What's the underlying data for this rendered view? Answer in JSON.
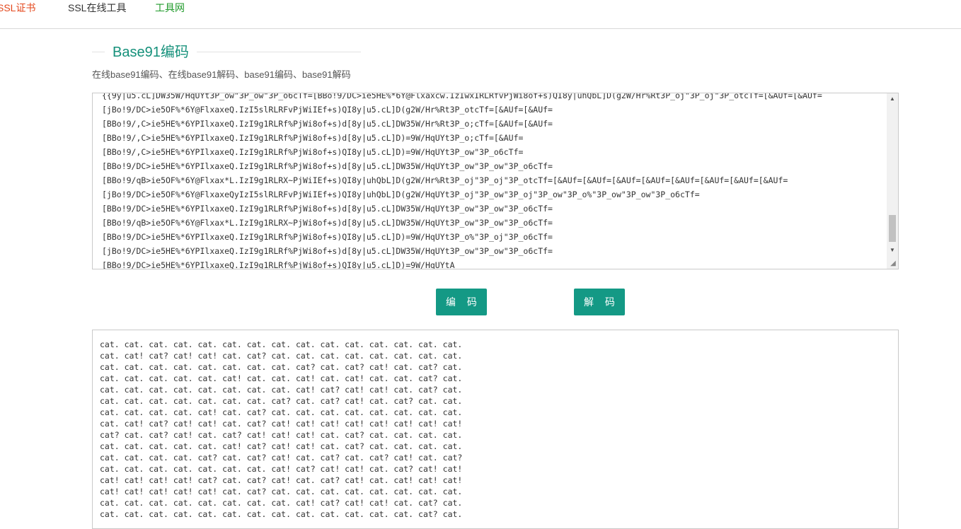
{
  "nav": {
    "ssl_cert": "SSL证书",
    "ssl_tools": "SSL在线工具",
    "tools_net": "工具网"
  },
  "page": {
    "title": "Base91编码",
    "subtitle": "在线base91编码、在线base91解码、base91编码、base91解码"
  },
  "input": {
    "text": "{{9y|u5.cL]DW35W/HqUYt3P_ow\"3P_ow\"3P_o6cTf=[BBo!9/DC>ie5HE%*6Y@Flxaxcw.IzIwxIRLRfvPjWi8of+s)QI8y|uhQbL]D(g2W/Hr%Rt3P_oj\"3P_oj\"3P_otcTf=[&AUf=[&AUf=\n[jBo!9/DC>ie5OF%*6Y@FlxaxeQ.IzI5slRLRFvPjWiIEf+s)QI8y|u5.cL]D(g2W/Hr%Rt3P_otcTf=[&AUf=[&AUf=\n[BBo!9/,C>ie5HE%*6YPIlxaxeQ.IzI9g1RLRf%PjWi8of+s)d[8y|u5.cL]DW35W/Hr%Rt3P_o;cTf=[&AUf=[&AUf=\n[BBo!9/,C>ie5HE%*6YPIlxaxeQ.IzI9g1RLRf%PjWi8of+s)d[8y|u5.cL]D)=9W/HqUYt3P_o;cTf=[&AUf=\n[BBo!9/,C>ie5HE%*6YPIlxaxeQ.IzI9g1RLRf%PjWi8of+s)QI8y|u5.cL]D)=9W/HqUYt3P_ow\"3P_o6cTf=\n[BBo!9/DC>ie5HE%*6YPIlxaxeQ.IzI9g1RLRf%PjWi8of+s)d[8y|u5.cL]DW35W/HqUYt3P_ow\"3P_ow\"3P_o6cTf=\n[BBo!9/qB>ie5OF%*6Y@Flxax*L.IzI9g1RLRX~PjWiIEf+s)QI8y|uhQbL]D(g2W/Hr%Rt3P_oj\"3P_oj\"3P_otcTf=[&AUf=[&AUf=[&AUf=[&AUf=[&AUf=[&AUf=[&AUf=[&AUf=\n[jBo!9/DC>ie5OF%*6Y@FlxaxeQyIzI5slRLRFvPjWiIEf+s)QI8y|uhQbL]D(g2W/HqUYt3P_oj\"3P_ow\"3P_oj\"3P_ow\"3P_o%\"3P_ow\"3P_ow\"3P_o6cTf=\n[BBo!9/DC>ie5HE%*6YPIlxaxeQ.IzI9g1RLRf%PjWi8of+s)d[8y|u5.cL]DW35W/HqUYt3P_ow\"3P_ow\"3P_o6cTf=\n[BBo!9/qB>ie5OF%*6Y@Flxax*L.IzI9g1RLRX~PjWi8of+s)d[8y|u5.cL]DW35W/HqUYt3P_ow\"3P_ow\"3P_o6cTf=\n[BBo!9/DC>ie5HE%*6YPIlxaxeQ.IzI9g1RLRf%PjWi8of+s)QI8y|u5.cL]D)=9W/HqUYt3P_o%\"3P_oj\"3P_o6cTf=\n[jBo!9/DC>ie5HE%*6YPIlxaxeQ.IzI9g1RLRf%PjWi8of+s)d[8y|u5.cL]DW35W/HqUYt3P_ow\"3P_ow\"3P_o6cTf=\n[BBo!9/DC>ie5HE%*6YPIlxaxeQ.IzI9g1RLRf%PjWi8of+s)QI8y|u5.cL]D)=9W/HqUYtA"
  },
  "buttons": {
    "encode": "编 码",
    "decode": "解 码"
  },
  "output": {
    "text": "cat. cat. cat. cat. cat. cat. cat. cat. cat. cat. cat. cat. cat. cat. cat.\ncat. cat! cat? cat! cat! cat. cat? cat. cat. cat. cat. cat. cat. cat. cat.\ncat. cat. cat. cat. cat. cat. cat. cat. cat? cat. cat? cat! cat. cat? cat.\ncat. cat. cat. cat. cat. cat! cat. cat. cat! cat. cat! cat. cat. cat? cat.\ncat. cat. cat. cat. cat. cat. cat. cat. cat! cat? cat! cat! cat. cat? cat.\ncat. cat. cat. cat. cat. cat. cat. cat? cat. cat? cat! cat. cat? cat. cat.\ncat. cat. cat. cat. cat! cat. cat? cat. cat. cat. cat. cat. cat. cat. cat.\ncat. cat! cat? cat! cat! cat. cat? cat! cat! cat! cat! cat! cat! cat! cat!\ncat? cat. cat? cat! cat. cat? cat! cat! cat! cat. cat? cat. cat. cat. cat.\ncat. cat. cat. cat. cat. cat! cat? cat! cat! cat. cat? cat. cat. cat. cat.\ncat. cat. cat. cat. cat? cat. cat? cat! cat. cat? cat. cat? cat! cat. cat?\ncat. cat. cat. cat. cat. cat. cat. cat! cat? cat! cat! cat. cat? cat! cat!\ncat! cat! cat! cat! cat? cat. cat? cat! cat. cat? cat! cat. cat! cat! cat!\ncat! cat! cat! cat! cat! cat. cat? cat. cat. cat. cat. cat. cat. cat. cat.\ncat. cat. cat. cat. cat. cat. cat. cat. cat! cat? cat! cat! cat. cat? cat.\ncat. cat. cat. cat. cat. cat. cat. cat. cat. cat. cat. cat. cat. cat? cat."
  },
  "icons": {
    "scroll_up": "scroll-up-arrow-icon",
    "scroll_down": "scroll-down-arrow-icon",
    "resize": "resize-grip-icon"
  },
  "colors": {
    "brand_green": "#149985",
    "title_green": "#14907a",
    "nav_red": "#e4481d",
    "nav_green": "#1f9a2a"
  }
}
